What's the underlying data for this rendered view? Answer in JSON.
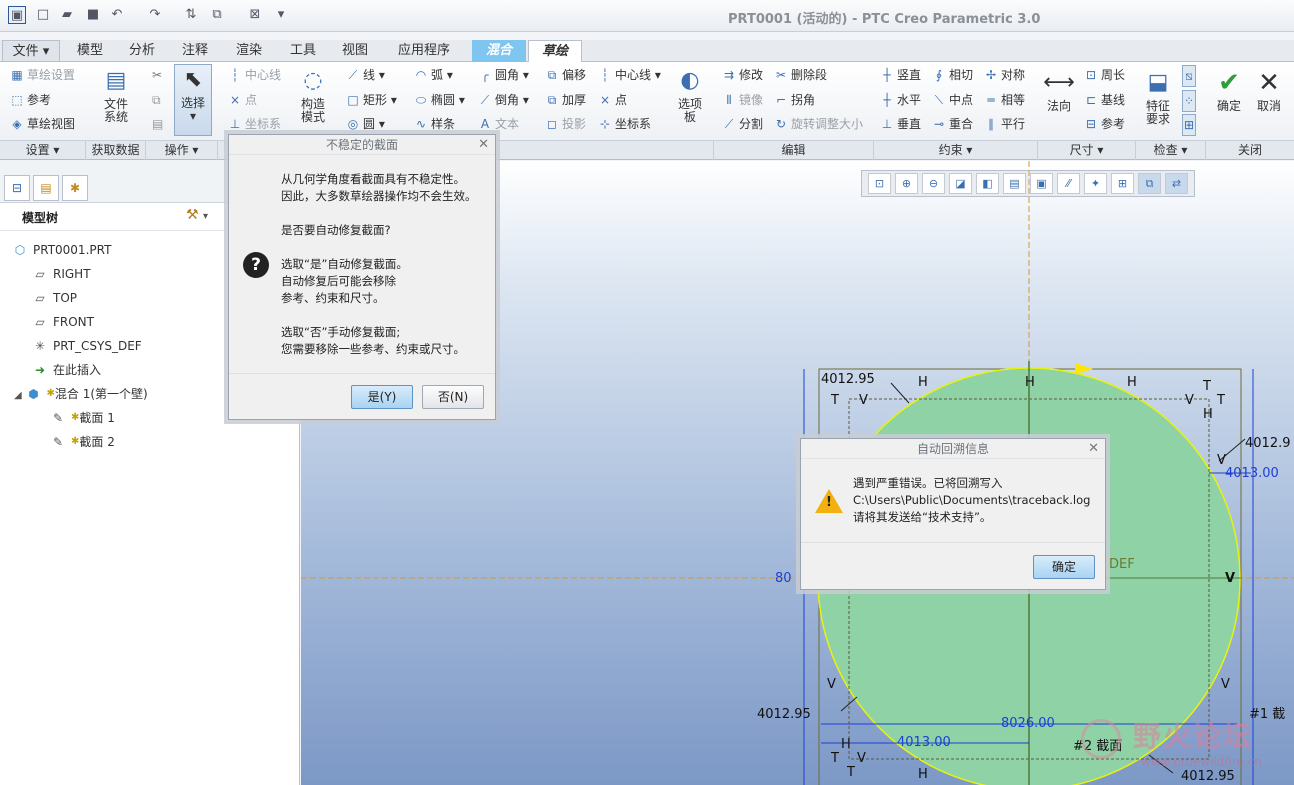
{
  "window": {
    "title": "PRT0001 (活动的) - PTC Creo Parametric 3.0"
  },
  "quick_access": [
    "app-icon",
    "new-icon",
    "open-icon",
    "save-icon",
    "undo-icon",
    "redo-icon",
    "regenerate-icon",
    "windows-icon",
    "close-window-icon",
    "customize-icon"
  ],
  "tabs": {
    "file": "文件",
    "items": [
      "模型",
      "分析",
      "注释",
      "渲染",
      "工具",
      "视图",
      "应用程序"
    ],
    "blend": "混合",
    "sketch": "草绘"
  },
  "ribbon": {
    "setup": {
      "sketch_setup": "草绘设置",
      "reference": "参考",
      "sketch_view": "草绘视图"
    },
    "file_system": "文件\n系统",
    "ops": {
      "select": "选择"
    },
    "datum": {
      "centerline": "中心线",
      "point": "点",
      "csys": "坐标系"
    },
    "construction": "构造\n模式",
    "sketch": {
      "line": "线",
      "rect": "矩形",
      "circle": "圆",
      "arc": "弧",
      "ellipse": "椭圆",
      "spline": "样条",
      "fillet": "圆角",
      "chamfer": "倒角",
      "text": "文本",
      "offset": "偏移",
      "thicken": "加厚",
      "project": "投影",
      "centerline": "中心线",
      "point": "点",
      "csys": "坐标系",
      "palette": "选项\n板"
    },
    "edit": {
      "modify": "修改",
      "mirror": "镜像",
      "divide": "分割",
      "delete_segment": "删除段",
      "corner": "拐角",
      "rotate_resize": "旋转调整大小"
    },
    "constrain": {
      "vertical": "竖直",
      "horizontal": "水平",
      "perpendicular": "垂直",
      "tangent": "相切",
      "midpoint": "中点",
      "coincident": "重合",
      "symmetric": "对称",
      "equal": "相等",
      "parallel": "平行"
    },
    "dimension": {
      "normal": "法向",
      "perimeter": "周长",
      "baseline": "基线",
      "reference": "参考"
    },
    "inspect": {
      "feature_req": "特征\n要求"
    },
    "close": {
      "ok": "确定",
      "cancel": "取消"
    }
  },
  "groups": {
    "setup": "设置",
    "get_data": "获取数据",
    "ops": "操作",
    "sketch": "草绘",
    "edit": "编辑",
    "constrain": "约束",
    "dimension": "尺寸",
    "inspect": "检查",
    "close": "关闭"
  },
  "model_tree": {
    "title": "模型树",
    "items": [
      {
        "label": "PRT0001.PRT",
        "icon": "part-icon"
      },
      {
        "label": "RIGHT",
        "icon": "datum-plane-icon"
      },
      {
        "label": "TOP",
        "icon": "datum-plane-icon"
      },
      {
        "label": "FRONT",
        "icon": "datum-plane-icon"
      },
      {
        "label": "PRT_CSYS_DEF",
        "icon": "csys-icon"
      },
      {
        "label": "在此插入",
        "icon": "insert-arrow-icon"
      },
      {
        "label": "混合 1(第一个壁)",
        "icon": "blend-feature-icon"
      },
      {
        "label": "截面 1",
        "icon": "section-sketch-icon"
      },
      {
        "label": "截面 2",
        "icon": "section-sketch-icon"
      }
    ]
  },
  "dialog_unstable": {
    "title": "不稳定的截面",
    "lines1": [
      "从几何学角度看截面具有不稳定性。",
      "因此，大多数草绘器操作均不会生效。"
    ],
    "question": "是否要自动修复截面?",
    "lines2": [
      "选取“是”自动修复截面。",
      "自动修复后可能会移除",
      "参考、约束和尺寸。"
    ],
    "lines3": [
      "选取“否”手动修复截面;",
      "您需要移除一些参考、约束或尺寸。"
    ],
    "yes": "是(Y)",
    "no": "否(N)"
  },
  "dialog_traceback": {
    "title": "自动回溯信息",
    "lines": [
      "遇到严重错误。已将回溯写入",
      "C:\\Users\\Public\\Documents\\traceback.log",
      "请将其发送给“技术支持”。"
    ],
    "ok": "确定"
  },
  "sketch": {
    "dims": {
      "d1": "4012.95",
      "d2": "4012.9",
      "d3": "4013.00",
      "d4": "4012.95",
      "d5": "8026.00",
      "d6": "4013.00",
      "d7": "4012.95",
      "d8": "80",
      "def_label": "DEF"
    },
    "labels": {
      "section1": "#1 截",
      "section2": "#2 截面"
    }
  },
  "watermark": {
    "cn": "野火论坛",
    "url": "www.proewildfire.cn"
  },
  "colors": {
    "accent": "#3b6fb0",
    "fill": "#8fd2a6",
    "dim_blue": "#1d3fd4"
  }
}
